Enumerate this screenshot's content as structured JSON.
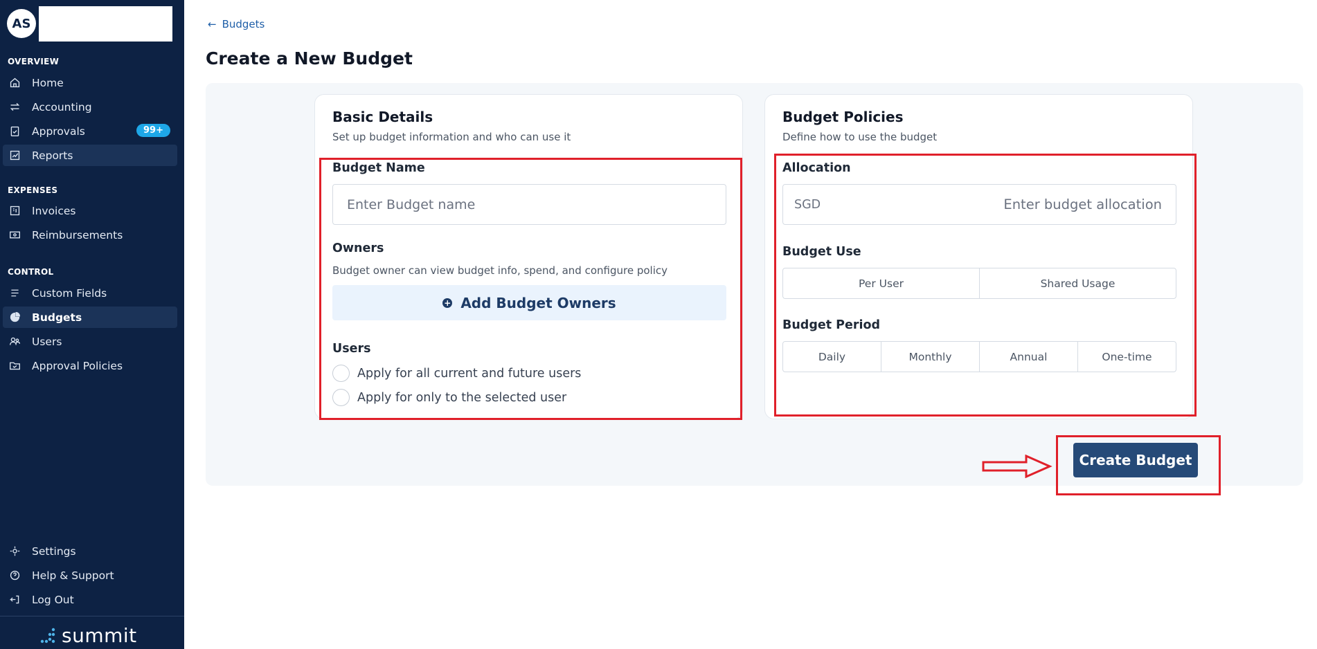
{
  "sidebar": {
    "avatar_initials": "AS",
    "sections": {
      "overview": "OVERVIEW",
      "expenses": "EXPENSES",
      "control": "CONTROL"
    },
    "items": {
      "home": "Home",
      "accounting": "Accounting",
      "approvals": "Approvals",
      "approvals_badge": "99+",
      "reports": "Reports",
      "invoices": "Invoices",
      "reimbursements": "Reimbursements",
      "custom_fields": "Custom Fields",
      "budgets": "Budgets",
      "users": "Users",
      "approval_policies": "Approval Policies",
      "settings": "Settings",
      "help": "Help & Support",
      "logout": "Log Out"
    },
    "brand": "summit"
  },
  "header": {
    "back_label": "Budgets",
    "page_title": "Create a New Budget"
  },
  "basic_details": {
    "title": "Basic Details",
    "subtitle": "Set up budget information and who can use it",
    "budget_name_label": "Budget Name",
    "budget_name_placeholder": "Enter Budget name",
    "owners_label": "Owners",
    "owners_help": "Budget owner can view budget info, spend, and configure policy",
    "add_owners_label": "Add Budget Owners",
    "users_label": "Users",
    "users_options": [
      "Apply for all current and future users",
      "Apply for only to the selected user"
    ]
  },
  "budget_policies": {
    "title": "Budget Policies",
    "subtitle": "Define how to use the budget",
    "allocation_label": "Allocation",
    "currency": "SGD",
    "allocation_placeholder": "Enter budget allocation",
    "budget_use_label": "Budget Use",
    "budget_use_options": [
      "Per User",
      "Shared Usage"
    ],
    "budget_period_label": "Budget Period",
    "budget_period_options": [
      "Daily",
      "Monthly",
      "Annual",
      "One-time"
    ]
  },
  "actions": {
    "create_label": "Create Budget"
  },
  "colors": {
    "sidebar_bg": "#0d2244",
    "primary": "#264a78",
    "annotation_red": "#e0202a",
    "badge": "#1ea7e8"
  }
}
